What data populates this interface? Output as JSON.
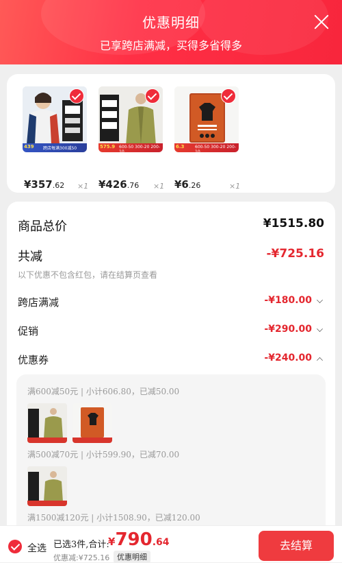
{
  "header": {
    "title": "优惠明细",
    "subtitle": "已享跨店满减，买得多省得多"
  },
  "products": [
    {
      "promo_price": "439",
      "promo_text": "跨店每满300减50",
      "price_int": "¥357",
      "price_dec": ".62",
      "qty": "×1"
    },
    {
      "promo_price": "575.9",
      "promo_text": "600-50 300-20 200-10",
      "price_int": "¥426",
      "price_dec": ".76",
      "qty": "×1"
    },
    {
      "promo_price": "6.3",
      "promo_text": "600-50 300-20 200-10",
      "price_int": "¥6",
      "price_dec": ".26",
      "qty": "×1"
    }
  ],
  "summary": {
    "total_label": "商品总价",
    "total_value": "¥1515.80",
    "reduce_label": "共减",
    "reduce_value": "-¥725.16",
    "reduce_note": "以下优惠不包含红包，请在结算页查看",
    "items": [
      {
        "label": "跨店满减",
        "value": "-¥180.00",
        "chevron": "down"
      },
      {
        "label": "促销",
        "value": "-¥290.00",
        "chevron": "down"
      },
      {
        "label": "优惠券",
        "value": "-¥240.00",
        "chevron": "up"
      }
    ]
  },
  "coupon_groups": [
    {
      "label": "满600减50元 | 小计606.80，已减50.00"
    },
    {
      "label": "满500减70元 | 小计599.90，已减70.00"
    },
    {
      "label": "满1500减120元 | 小计1508.90，已减120.00"
    }
  ],
  "bottom_bar": {
    "select_all": "全选",
    "selected_text": "已选3件,合计:",
    "price_currency": "¥",
    "price_int": "790",
    "price_dec": ".64",
    "discount_text": "优惠减:¥725.16",
    "detail_link": "优惠明细",
    "checkout": "去结算"
  },
  "colors": {
    "accent": "#ef2c3a",
    "price_red": "#e4272f",
    "header_start": "#ff5a57",
    "header_end": "#f8263c"
  }
}
